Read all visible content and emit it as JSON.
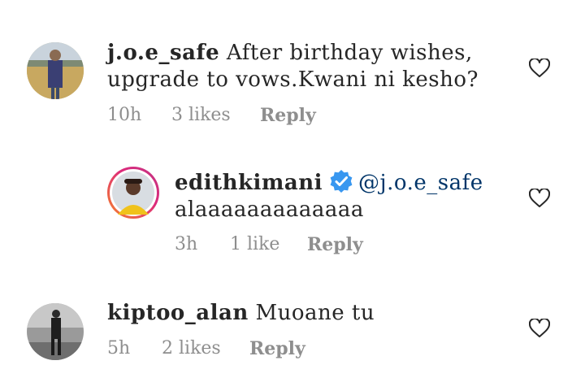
{
  "comments": [
    {
      "username": "j.o.e_safe",
      "text": "After birthday wishes,",
      "text_line2": "upgrade to vows.Kwani ni kesho?",
      "time": "10h",
      "likes": "3 likes",
      "reply": "Reply",
      "heart_icon": "heart-outline-icon"
    },
    {
      "username": "edithkimani",
      "verified": true,
      "mention": "@j.o.e_safe",
      "text": "alaaaaaaaaaaaaa",
      "time": "3h",
      "likes": "1 like",
      "reply": "Reply",
      "heart_icon": "heart-outline-icon"
    },
    {
      "username": "kiptoo_alan",
      "text": "Muoane tu",
      "time": "5h",
      "likes": "2 likes",
      "reply": "Reply",
      "heart_icon": "heart-outline-icon"
    }
  ],
  "colors": {
    "text": "#262626",
    "muted": "#8e8e8e",
    "mention": "#003569",
    "verified": "#3897f0",
    "story_ring_start": "#f58529",
    "story_ring_end": "#dd2a7b"
  }
}
